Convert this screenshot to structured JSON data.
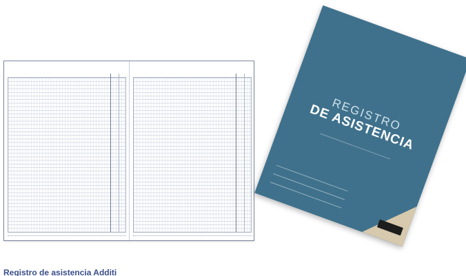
{
  "colors": {
    "cover_blue": "#3f718c",
    "caption_blue": "#3a4e8a"
  },
  "cover": {
    "title_line1": "REGISTRO",
    "title_line2": "DE ASISTENCIA"
  },
  "caption": "Registro de asistencia Additi"
}
